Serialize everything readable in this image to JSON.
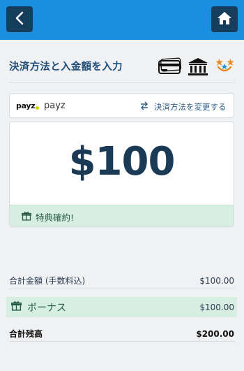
{
  "header": {
    "back_icon": "chevron-left-icon",
    "home_icon": "home-icon"
  },
  "section": {
    "title": "決済方法と入金額を入力",
    "icons": [
      "card-icon",
      "bank-icon",
      "star-badge-icon"
    ]
  },
  "method": {
    "logo_text": "payz",
    "name": "payz",
    "change_label": "決済方法を変更する",
    "change_icon": "swap-icon"
  },
  "amount": {
    "value": "$100",
    "bonus_note": "特典確約!"
  },
  "summary": {
    "subtotal_label": "合計金額 (手数料込)",
    "subtotal_value": "$100.00",
    "bonus_label": "ボーナス",
    "bonus_value": "$100.00",
    "total_label": "合計残高",
    "total_value": "$200.00"
  },
  "colors": {
    "topbar": "#1a8fe0",
    "nav_button": "#163d5c",
    "title": "#1f4e79",
    "bonus_bg": "#d7efe3",
    "accent_orange": "#e8891c"
  }
}
